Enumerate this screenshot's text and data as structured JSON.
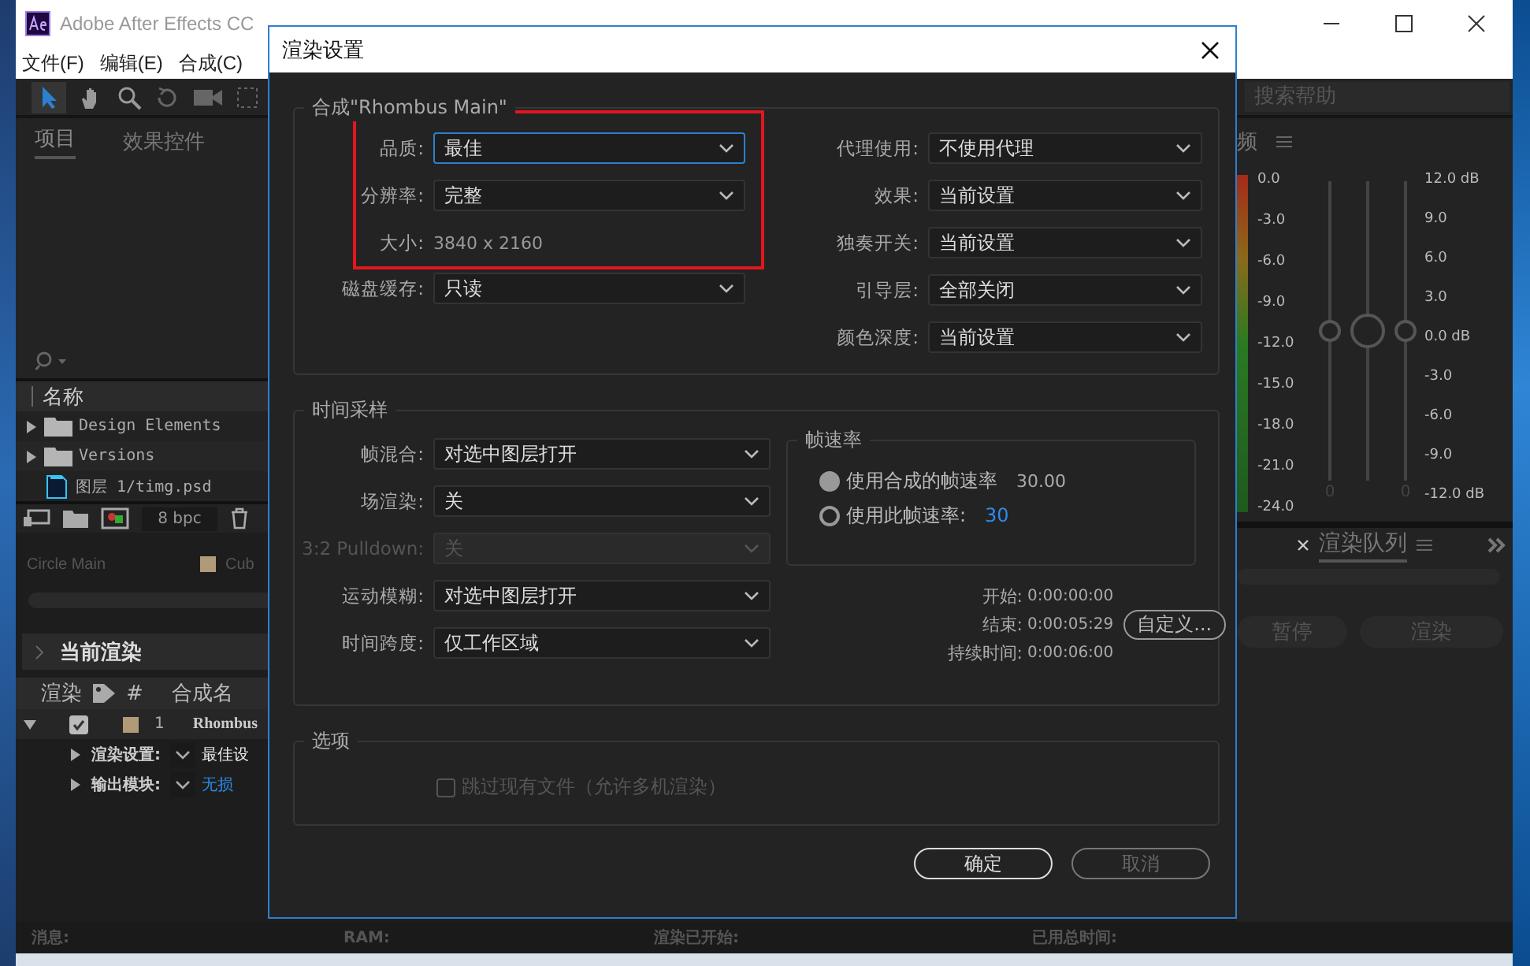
{
  "app_window": {
    "title": "Adobe After Effects CC",
    "menu": [
      "文件(F)",
      "编辑(E)",
      "合成(C)"
    ],
    "search": {
      "placeholder": "搜索帮助"
    }
  },
  "project_panel": {
    "tabs": [
      {
        "label": "项目",
        "selected": true
      },
      {
        "label": "效果控件",
        "selected": false
      }
    ],
    "column": "名称",
    "items": [
      {
        "kind": "folder",
        "name": "Design Elements"
      },
      {
        "kind": "folder",
        "name": "Versions"
      },
      {
        "kind": "psd",
        "name": "图层 1/timg.psd"
      }
    ],
    "bit_depth": "8 bpc"
  },
  "comp_tabs": [
    {
      "label": "Circle Main"
    },
    {
      "label": "Cub",
      "color": "#b09a78"
    }
  ],
  "render_queue": {
    "current_render": "当前渲染",
    "columns": [
      "渲染",
      "#",
      "合成名"
    ],
    "item": {
      "checked": true,
      "color": "#b09a78",
      "index": "1",
      "name": "Rhombus",
      "settings": [
        {
          "label": "渲染设置:",
          "value": "最佳设",
          "link": false
        },
        {
          "label": "输出模块:",
          "value": "无损",
          "link": true
        }
      ]
    },
    "tab": "渲染队列",
    "buttons": [
      "暂停",
      "渲染"
    ]
  },
  "audio_panel": {
    "tab": "频",
    "left_scale": [
      "0.0",
      "-3.0",
      "-6.0",
      "-9.0",
      "-12.0",
      "-15.0",
      "-18.0",
      "-21.0",
      "-24.0"
    ],
    "right_scale": [
      "12.0 dB",
      "9.0",
      "6.0",
      "3.0",
      "0.0 dB",
      "-3.0",
      "-6.0",
      "-9.0",
      "-12.0 dB"
    ],
    "sliders": [
      {
        "kind": "channel",
        "level": 0.5,
        "reading": "0"
      },
      {
        "kind": "master",
        "level": 0.5
      },
      {
        "kind": "channel",
        "level": 0.5,
        "reading": "0"
      }
    ]
  },
  "status_bar": [
    "消息:",
    "RAM:",
    "渲染已开始:",
    "已用总时间:"
  ],
  "dialog": {
    "title": "渲染设置",
    "composition": {
      "title": "合成\"Rhombus Main\"",
      "left": [
        {
          "kind": "select",
          "label": "品质:",
          "value": "最佳",
          "focused": true,
          "highlighted": true
        },
        {
          "kind": "select",
          "label": "分辨率:",
          "value": "完整",
          "focused": false,
          "highlighted": true
        },
        {
          "kind": "info",
          "label": "大小:",
          "value": "3840 x 2160",
          "highlighted": true
        },
        {
          "kind": "select",
          "label": "磁盘缓存:",
          "value": "只读",
          "focused": false,
          "highlighted": false
        }
      ],
      "right": [
        {
          "label": "代理使用:",
          "value": "不使用代理"
        },
        {
          "label": "效果:",
          "value": "当前设置"
        },
        {
          "label": "独奏开关:",
          "value": "当前设置"
        },
        {
          "label": "引导层:",
          "value": "全部关闭"
        },
        {
          "label": "颜色深度:",
          "value": "当前设置"
        }
      ]
    },
    "time_sampling": {
      "title": "时间采样",
      "fields": [
        {
          "label": "帧混合:",
          "value": "对选中图层打开",
          "disabled": false
        },
        {
          "label": "场渲染:",
          "value": "关",
          "disabled": false
        },
        {
          "label": "3:2 Pulldown:",
          "value": "关",
          "disabled": true
        },
        {
          "label": "运动模糊:",
          "value": "对选中图层打开",
          "disabled": false
        },
        {
          "label": "时间跨度:",
          "value": "仅工作区域",
          "disabled": false
        }
      ],
      "frame_rate": {
        "title": "帧速率",
        "options": [
          {
            "label": "使用合成的帧速率",
            "value": "30.00",
            "selected": true,
            "editable": false
          },
          {
            "label": "使用此帧速率:",
            "value": "30",
            "selected": false,
            "editable": true
          }
        ]
      },
      "times": [
        {
          "label": "开始:",
          "value": "0:00:00:00"
        },
        {
          "label": "结束:",
          "value": "0:00:05:29"
        },
        {
          "label": "持续时间:",
          "value": "0:00:06:00"
        }
      ],
      "custom_button": "自定义..."
    },
    "options": {
      "title": "选项",
      "checkbox": {
        "label": "跳过现有文件（允许多机渲染）",
        "checked": false,
        "disabled": true
      }
    },
    "buttons": [
      {
        "label": "确定",
        "primary": true
      },
      {
        "label": "取消",
        "primary": false
      }
    ]
  }
}
